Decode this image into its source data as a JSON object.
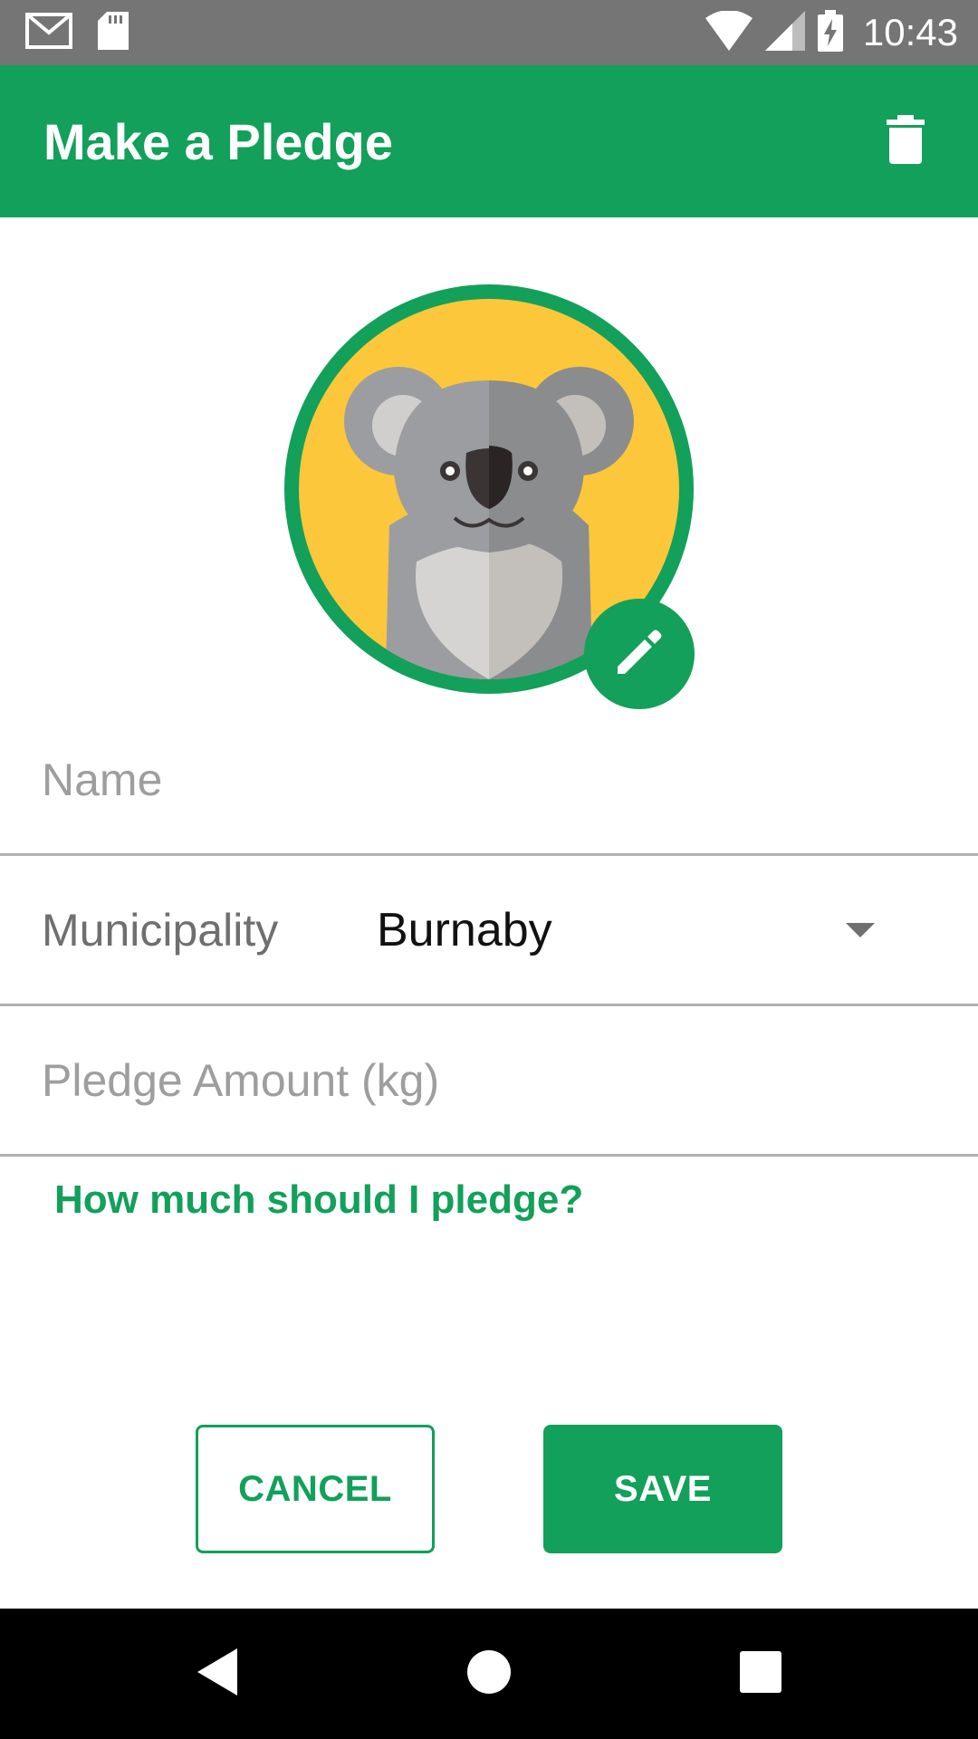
{
  "status_bar": {
    "time": "10:43",
    "icons": [
      "gmail-icon",
      "sd-card-icon",
      "wifi-icon",
      "signal-icon",
      "battery-charging-icon"
    ]
  },
  "app_bar": {
    "title": "Make a Pledge",
    "delete_icon": "trash-icon"
  },
  "avatar": {
    "image": "koala",
    "edit_icon": "pencil-icon"
  },
  "form": {
    "name_placeholder": "Name",
    "municipality_label": "Municipality",
    "municipality_value": "Burnaby",
    "pledge_placeholder": "Pledge Amount (kg)",
    "help_link": "How much should I pledge?"
  },
  "actions": {
    "cancel_label": "CANCEL",
    "save_label": "SAVE"
  },
  "nav": {
    "icons": [
      "back-icon",
      "home-icon",
      "recents-icon"
    ]
  },
  "colors": {
    "primary": "#12a05a",
    "status_bar": "#757575",
    "avatar_bg": "#fcc73a"
  }
}
